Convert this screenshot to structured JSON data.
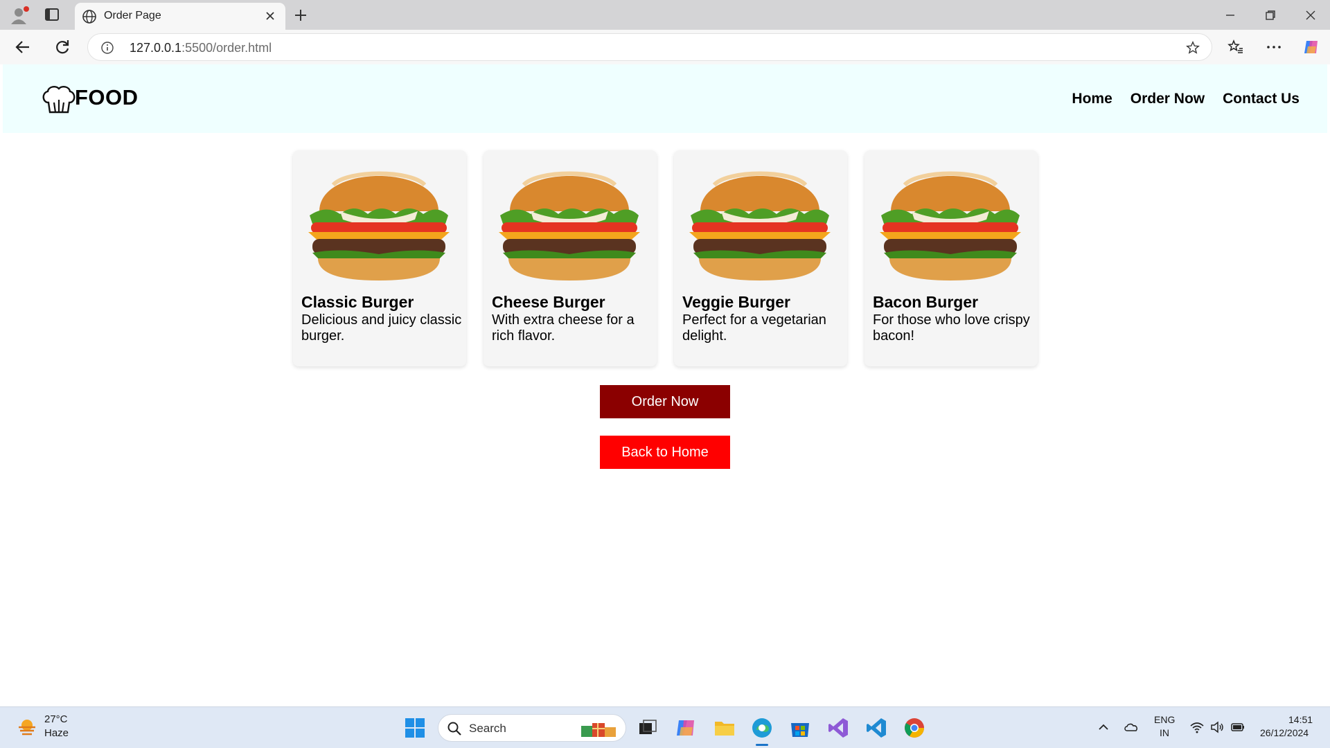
{
  "browser": {
    "tab_title": "Order Page",
    "url_host": "127.0.0.1",
    "url_rest": ":5500/order.html"
  },
  "site": {
    "logo_text": "FOOD",
    "nav": [
      "Home",
      "Order Now",
      "Contact Us"
    ]
  },
  "menu": {
    "items": [
      {
        "name": "Classic Burger",
        "desc": "Delicious and juicy classic burger."
      },
      {
        "name": "Cheese Burger",
        "desc": "With extra cheese for a rich flavor."
      },
      {
        "name": "Veggie Burger",
        "desc": "Perfect for a vegetarian delight."
      },
      {
        "name": "Bacon Burger",
        "desc": "For those who love crispy bacon!"
      }
    ],
    "order_button": "Order Now",
    "home_button": "Back to Home"
  },
  "colors": {
    "header_bg": "#efffff",
    "order_button": "#8b0000",
    "home_button": "#ff0000"
  },
  "taskbar": {
    "temperature": "27°C",
    "condition": "Haze",
    "search_label": "Search",
    "lang_line1": "ENG",
    "lang_line2": "IN",
    "time": "14:51",
    "date": "26/12/2024"
  }
}
